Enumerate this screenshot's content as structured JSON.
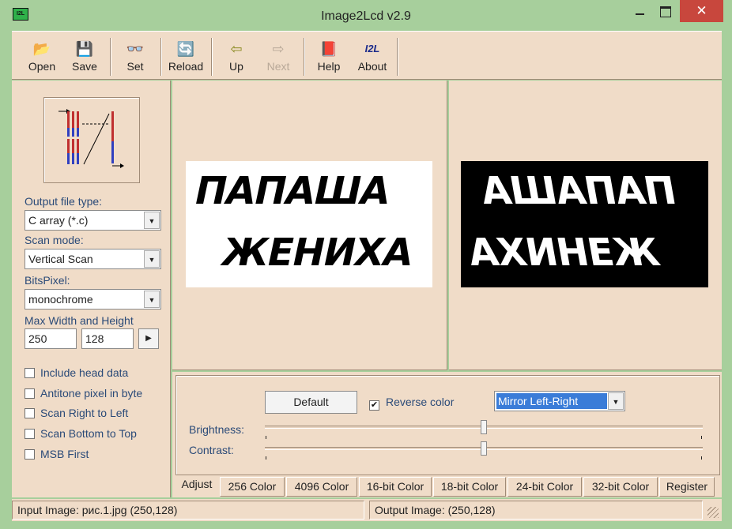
{
  "window": {
    "app_icon_text": "I2L",
    "title": "Image2Lcd v2.9",
    "close_glyph": "✕"
  },
  "toolbar": {
    "items": [
      {
        "label": "Open",
        "icon": "open-folder-icon",
        "glyph": "📂"
      },
      {
        "label": "Save",
        "icon": "floppy-disk-icon",
        "glyph": "💾"
      },
      {
        "label": "Set",
        "icon": "glasses-icon",
        "glyph": "👓"
      },
      {
        "label": "Reload",
        "icon": "reload-icon",
        "glyph": "🔄"
      },
      {
        "label": "Up",
        "icon": "arrow-left-icon",
        "glyph": "⇦"
      },
      {
        "label": "Next",
        "icon": "arrow-right-icon",
        "glyph": "⇨"
      },
      {
        "label": "Help",
        "icon": "help-book-icon",
        "glyph": "📕"
      },
      {
        "label": "About",
        "icon": "i2l-logo-icon",
        "glyph": "I2L"
      }
    ]
  },
  "left": {
    "output_label": "Output file type:",
    "output_value": "C array (*.c)",
    "scan_label": "Scan mode:",
    "scan_value": "Vertical Scan",
    "bits_label": "BitsPixel:",
    "bits_value": "monochrome",
    "maxwh_label": "Max Width and Height",
    "max_width": "250",
    "max_height": "128",
    "checkboxes": [
      {
        "label": "Include head data",
        "checked": false
      },
      {
        "label": "Antitone pixel in byte",
        "checked": false
      },
      {
        "label": "Scan Right to Left",
        "checked": false
      },
      {
        "label": "Scan Bottom to Top",
        "checked": false
      },
      {
        "label": "MSB First",
        "checked": false
      }
    ]
  },
  "input_image": {
    "line1": "ПАПАША",
    "line2": "ЖЕНИХА"
  },
  "output_image": {
    "line1": "АШАПАП",
    "line2": "АХИНЕЖ"
  },
  "adjust": {
    "default_label": "Default",
    "reverse_label": "Reverse color",
    "reverse_checked": true,
    "check_glyph": "✔",
    "mirror_value": "Mirror Left-Right",
    "brightness_label": "Brightness:",
    "brightness_value": 0.5,
    "contrast_label": "Contrast:",
    "contrast_value": 0.5
  },
  "tabs": [
    "Adjust",
    "256 Color",
    "4096 Color",
    "16-bit Color",
    "18-bit Color",
    "24-bit Color",
    "32-bit Color",
    "Register"
  ],
  "active_tab": "Adjust",
  "status": {
    "input": "Input Image: рис.1.jpg (250,128)",
    "output": "Output Image: (250,128)"
  }
}
